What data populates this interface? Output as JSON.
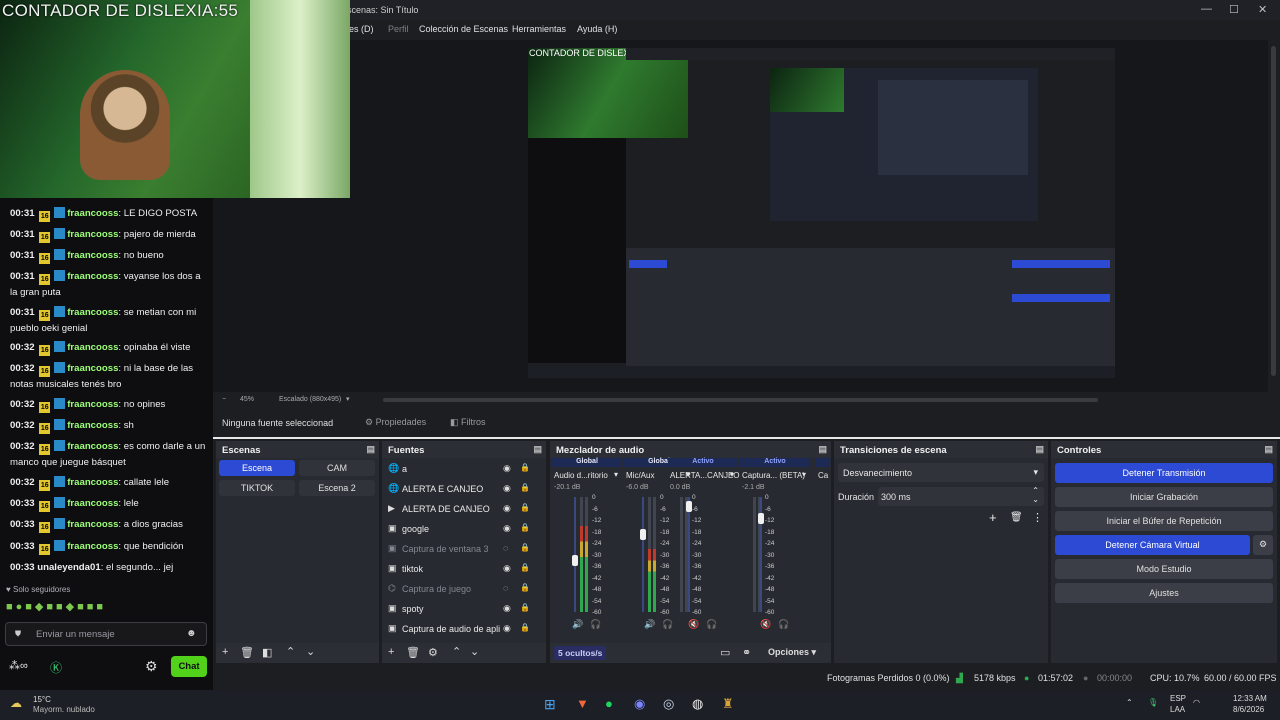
{
  "window": {
    "title": "Escenas: Sin Título"
  },
  "menu": {
    "items": [
      "eles (D)",
      "Perfil",
      "Colección de Escenas",
      "Herramientas",
      "Ayuda (H)"
    ]
  },
  "webcam": {
    "overlay_text": "CONTADOR DE DISLEXIA:55"
  },
  "chat": {
    "messages": [
      {
        "time": "00:31",
        "badge": "16",
        "user": "fraancooss",
        "text": "LE DIGO POSTA"
      },
      {
        "time": "00:31",
        "badge": "16",
        "user": "fraancooss",
        "text": "pajero de mierda"
      },
      {
        "time": "00:31",
        "badge": "16",
        "user": "fraancooss",
        "text": "no bueno"
      },
      {
        "time": "00:31",
        "badge": "16",
        "user": "fraancooss",
        "text": "vayanse los dos a la gran puta"
      },
      {
        "time": "00:31",
        "badge": "16",
        "user": "fraancooss",
        "text": "se metian con mi pueblo oeki genial"
      },
      {
        "time": "00:32",
        "badge": "16",
        "user": "fraancooss",
        "text": "opinaba él viste"
      },
      {
        "time": "00:32",
        "badge": "16",
        "user": "fraancooss",
        "text": "ni la base de las notas musicales tenés bro"
      },
      {
        "time": "00:32",
        "badge": "16",
        "user": "fraancooss",
        "text": "no opines"
      },
      {
        "time": "00:32",
        "badge": "16",
        "user": "fraancooss",
        "text": "sh"
      },
      {
        "time": "00:32",
        "badge": "16",
        "user": "fraancooss",
        "text": "es como darle a un manco que juegue básquet"
      },
      {
        "time": "00:32",
        "badge": "16",
        "user": "fraancooss",
        "text": "callate lele"
      },
      {
        "time": "00:33",
        "badge": "16",
        "user": "fraancooss",
        "text": "lele"
      },
      {
        "time": "00:33",
        "badge": "16",
        "user": "fraancooss",
        "text": "a dios gracias"
      },
      {
        "time": "00:33",
        "badge": "16",
        "user": "fraancooss",
        "text": "que bendición"
      },
      {
        "time": "00:33",
        "badge": "",
        "user": "unaleyenda01",
        "text": "el segundo... jej"
      }
    ],
    "followers_only": "Solo seguidores",
    "input_placeholder": "Enviar un mensaje",
    "chat_button": "Chat"
  },
  "preview_bar": {
    "zoom": "45%",
    "scale": "Escalado (880x495)"
  },
  "source_bar": {
    "selected": "Ninguna fuente seleccionad",
    "properties": "Propiedades",
    "filters": "Filtros"
  },
  "docks": {
    "scenes": {
      "title": "Escenas",
      "items": [
        "Escena",
        "CAM",
        "TIKTOK",
        "Escena 2"
      ]
    },
    "sources": {
      "title": "Fuentes",
      "items": [
        {
          "name": "a",
          "icon": "globe-icon",
          "dim": false
        },
        {
          "name": "ALERTA E CANJEO",
          "icon": "globe-icon",
          "dim": false
        },
        {
          "name": "ALERTA DE CANJEO",
          "icon": "play-icon",
          "dim": false
        },
        {
          "name": "google",
          "icon": "window-icon",
          "dim": false
        },
        {
          "name": "Captura de ventana 3",
          "icon": "window-icon",
          "dim": true
        },
        {
          "name": "tiktok",
          "icon": "window-icon",
          "dim": false
        },
        {
          "name": "Captura de juego",
          "icon": "gamepad-icon",
          "dim": true
        },
        {
          "name": "spoty",
          "icon": "window-icon",
          "dim": false
        },
        {
          "name": "Captura de audio de apli",
          "icon": "window-icon",
          "dim": false
        }
      ]
    },
    "mixer": {
      "title": "Mezclador de audio",
      "channels": [
        {
          "tag": "Global",
          "name": "Audio d...ritorio",
          "db": "-20.1 dB",
          "fader": 0.45
        },
        {
          "tag": "Global",
          "name": "Mic/Aux",
          "db": "-6.0 dB",
          "fader": 0.68
        },
        {
          "tag": "Activo",
          "name": "ALERTA...CANJEO",
          "db": "0.0 dB",
          "fader": 0.92
        },
        {
          "tag": "Activo",
          "name": "Captura... (BETA)",
          "db": "-2.1 dB",
          "fader": 0.82
        },
        {
          "tag": "",
          "name": "Ca",
          "db": "",
          "fader": 0
        }
      ],
      "scale": [
        "0",
        "-6",
        "-12",
        "-18",
        "-24",
        "-30",
        "-36",
        "-42",
        "-48",
        "-54",
        "-60"
      ],
      "hidden": "5 ocultos/s",
      "options": "Opciones"
    },
    "transitions": {
      "title": "Transiciones de escena",
      "type": "Desvanecimiento",
      "duration_label": "Duración",
      "duration": "300 ms"
    },
    "controls": {
      "title": "Controles",
      "buttons": [
        "Detener Transmisión",
        "Iniciar Grabación",
        "Iniciar el Búfer de Repetición",
        "Detener Cámara Virtual",
        "Modo Estudio",
        "Ajustes"
      ]
    }
  },
  "status": {
    "dropped": "Fotogramas Perdidos 0 (0.0%)",
    "bitrate": "5178 kbps",
    "live": "01:57:02",
    "rec": "00:00:00",
    "cpu": "CPU: 10.7%",
    "fps": "60.00 / 60.00 FPS"
  },
  "taskbar": {
    "temp": "15°C",
    "weather": "Mayorm. nublado",
    "lang1": "ESP",
    "lang2": "LAA",
    "time": "12:33 AM",
    "date": "8/6/2026"
  },
  "colors": {
    "accent": "#2c4ad3",
    "chat_user": "#9dff7a",
    "live": "#2fa84f"
  }
}
